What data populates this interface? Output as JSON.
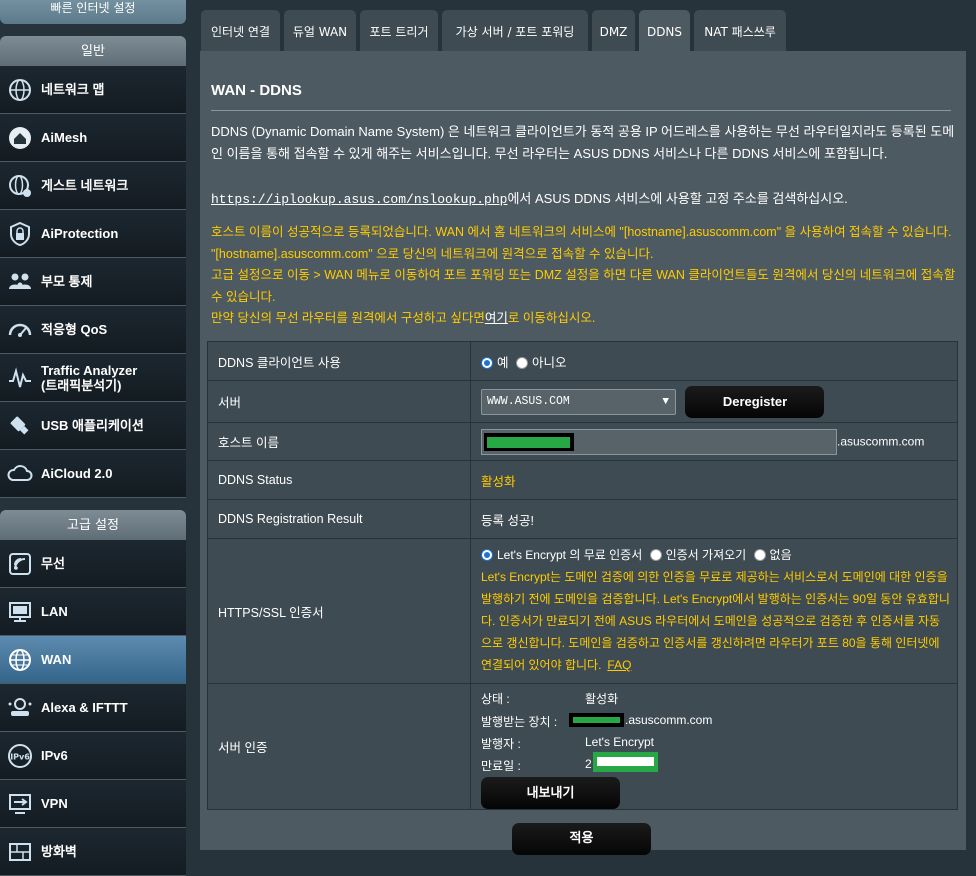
{
  "sidebar": {
    "section_general": "일반",
    "section_advanced": "고급 설정",
    "items": [
      {
        "label": "네트워크 맵",
        "icon": "globe-network-icon"
      },
      {
        "label": "AiMesh",
        "icon": "aimesh-house-icon"
      },
      {
        "label": "게스트 네트워크",
        "icon": "guest-globe-icon"
      },
      {
        "label": "AiProtection",
        "icon": "lock-shield-icon"
      },
      {
        "label": "부모 통제",
        "icon": "parents-icon"
      },
      {
        "label": "적응형 QoS",
        "icon": "gauge-icon"
      },
      {
        "label": "Traffic Analyzer\n(트래픽분석기)",
        "icon": "traffic-wave-icon"
      },
      {
        "label": "USB 애플리케이션",
        "icon": "usb-icon"
      },
      {
        "label": "AiCloud 2.0",
        "icon": "cloud-icon"
      }
    ],
    "advanced_items": [
      {
        "label": "무선",
        "icon": "wireless-icon"
      },
      {
        "label": "LAN",
        "icon": "lan-monitor-icon"
      },
      {
        "label": "WAN",
        "icon": "wan-globe-icon",
        "active": true
      },
      {
        "label": "Alexa & IFTTT",
        "icon": "alexa-icon"
      },
      {
        "label": "IPv6",
        "icon": "ipv6-icon"
      },
      {
        "label": "VPN",
        "icon": "vpn-icon"
      },
      {
        "label": "방화벽",
        "icon": "firewall-icon"
      }
    ]
  },
  "tabs": [
    "인터넷 연결",
    "듀얼 WAN",
    "포트 트리거",
    "가상 서버 / 포트 포워딩",
    "DMZ",
    "DDNS",
    "NAT 패스쓰루"
  ],
  "active_tab": "DDNS",
  "page": {
    "title": "WAN - DDNS",
    "description": "DDNS (Dynamic Domain Name System) 은 네트워크 클라이언트가 동적 공용 IP 어드레스를 사용하는 무선 라우터일지라도 등록된 도메인 이름을 통해 접속할 수 있게 해주는 서비스입니다. 무선 라우터는 ASUS DDNS 서비스나 다른 DDNS 서비스에 포함됩니다.",
    "lookup_url": "https://iplookup.asus.com/nslookup.php",
    "lookup_text": "에서 ASUS DDNS 서비스에 사용할 고정 주소를 검색하십시오.",
    "notice_1": "호스트 이름이 성공적으로 등록되었습니다. WAN 에서 홈 네트워크의 서비스에 \"[hostname].asuscomm.com\" 을 사용하여 접속할 수 있습니다. \"[hostname].asuscomm.com\" 으로 당신의 네트워크에 원격으로 접속할 수 있습니다.",
    "notice_2": "고급 설정으로 이동 > WAN 메뉴로 이동하여 포트 포워딩 또는 DMZ 설정을 하면 다른 WAN 클라이언트들도 원격에서 당신의 네트워크에 접속할 수 있습니다.",
    "notice_3_pre": "만약 당신의 무선 라우터를 원격에서 구성하고 싶다면",
    "notice_3_link": "여기",
    "notice_3_post": "로 이동하십시오."
  },
  "settings": {
    "enable_label": "DDNS 클라이언트 사용",
    "enable_yes": "예",
    "enable_no": "아니오",
    "server_label": "서버",
    "server_value": "WWW.ASUS.COM",
    "deregister_button": "Deregister",
    "hostname_label": "호스트 이름",
    "hostname_suffix": ".asuscomm.com",
    "status_label": "DDNS Status",
    "status_value": "활성화",
    "result_label": "DDNS Registration Result",
    "result_value": "등록 성공!",
    "https_label": "HTTPS/SSL 인증서",
    "https_opt1": "Let's Encrypt 의 무료 인증서",
    "https_opt2": "인증서 가져오기",
    "https_opt3": "없음",
    "https_desc": "Let's Encrypt는 도메인 검증에 의한 인증을 무료로 제공하는 서비스로서 도메인에 대한 인증을 발행하기 전에 도메인을 검증합니다. Let's Encrypt에서 발행하는 인증서는 90일 동안 유효합니다. 인증서가 만료되기 전에 ASUS 라우터에서 도메인을 성공적으로 검증한 후 인증서를 자동으로 갱신합니다. 도메인을 검증하고 인증서를 갱신하려면 라우터가 포트 80을 통해 인터넷에 연결되어 있어야 합니다.",
    "faq_link": "FAQ",
    "cert_label": "서버 인증",
    "cert_state_label": "상태 :",
    "cert_state_value": "활성화",
    "cert_issued_to_label": "발행받는 장치 :",
    "cert_issued_to_suffix": ".asuscomm.com",
    "cert_issuer_label": "발행자 :",
    "cert_issuer_value": "Let's Encrypt",
    "cert_expiry_label": "만료일 :",
    "cert_expiry_prefix": "2",
    "export_button": "내보내기",
    "apply_button": "적용"
  },
  "colors": {
    "notice_text": "#ffcc00",
    "panel_bg": "#4d5a62",
    "active_menu": "#4a7aa0",
    "redaction_green": "#27a745"
  }
}
